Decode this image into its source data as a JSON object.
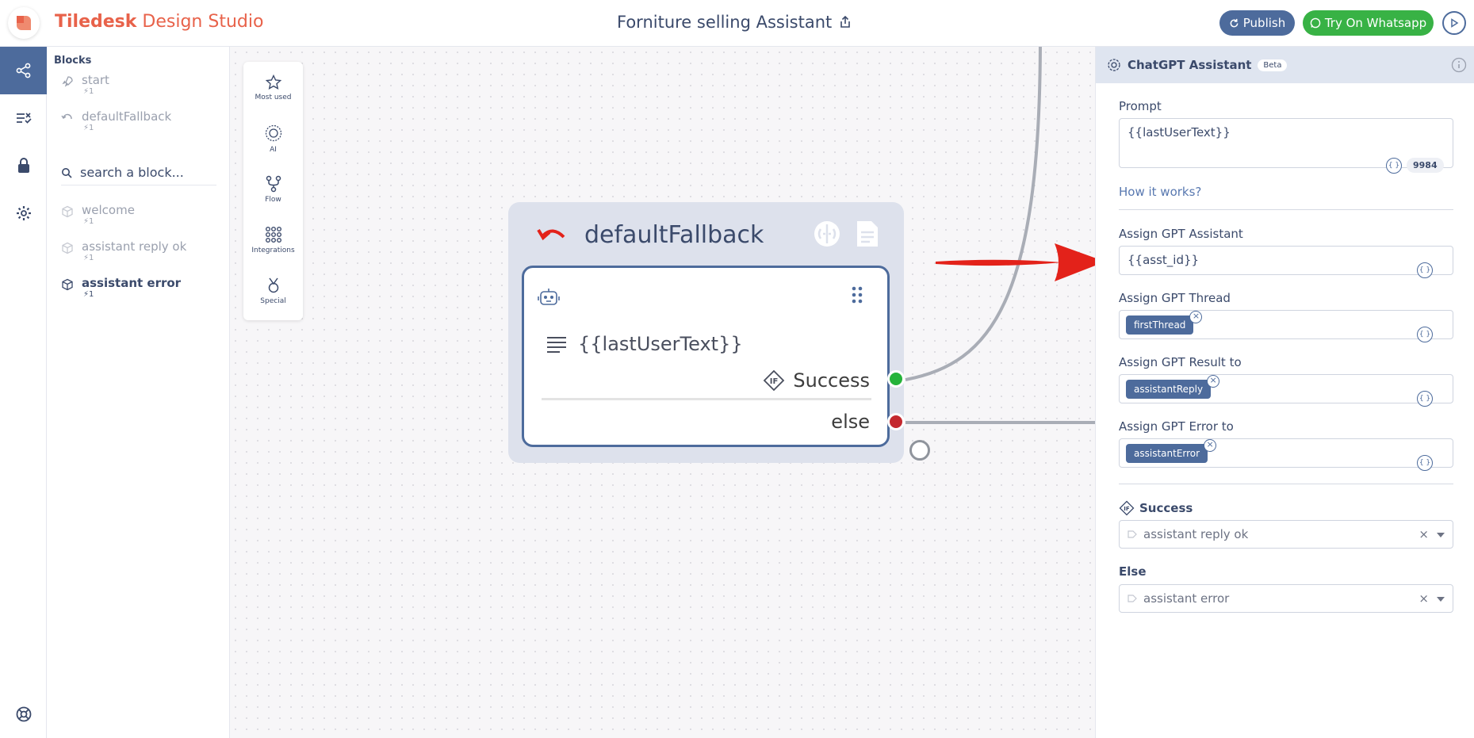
{
  "app": {
    "brand_bold": "Tiledesk",
    "brand_rest": " Design Studio",
    "document_title": "Forniture selling Assistant",
    "publish_label": "Publish",
    "whatsapp_label": "Try On Whatsapp"
  },
  "sidebar": {
    "title": "Blocks",
    "search_placeholder": "search a block...",
    "items_top": [
      {
        "name": "start",
        "count": "1"
      },
      {
        "name": "defaultFallback",
        "count": "1"
      }
    ],
    "items": [
      {
        "name": "welcome",
        "count": "1"
      },
      {
        "name": "assistant reply ok",
        "count": "1"
      },
      {
        "name": "assistant error",
        "count": "1"
      }
    ]
  },
  "palette": {
    "items": [
      "Most used",
      "AI",
      "Flow",
      "Integrations",
      "Special"
    ]
  },
  "node": {
    "title": "defaultFallback",
    "text": "{{lastUserText}}",
    "success_label": "Success",
    "else_label": "else"
  },
  "panel": {
    "title": "ChatGPT Assistant",
    "badge": "Beta",
    "prompt_label": "Prompt",
    "prompt_value": "{{lastUserText}}",
    "prompt_counter": "9984",
    "how_it_works": "How it works?",
    "assistant_label": "Assign GPT Assistant",
    "assistant_value": "{{asst_id}}",
    "thread_label": "Assign GPT Thread",
    "thread_chip": "firstThread",
    "result_label": "Assign GPT Result to",
    "result_chip": "assistantReply",
    "error_label": "Assign GPT Error to",
    "error_chip": "assistantError",
    "success_label": "Success",
    "success_value": "assistant reply ok",
    "else_label": "Else",
    "else_value": "assistant error"
  },
  "colors": {
    "brand": "#e8624a",
    "primary": "#4d6b9c",
    "whatsapp": "#38b245",
    "success_port": "#25b33a",
    "error_port": "#c4282e",
    "arrow": "#e3221a"
  }
}
